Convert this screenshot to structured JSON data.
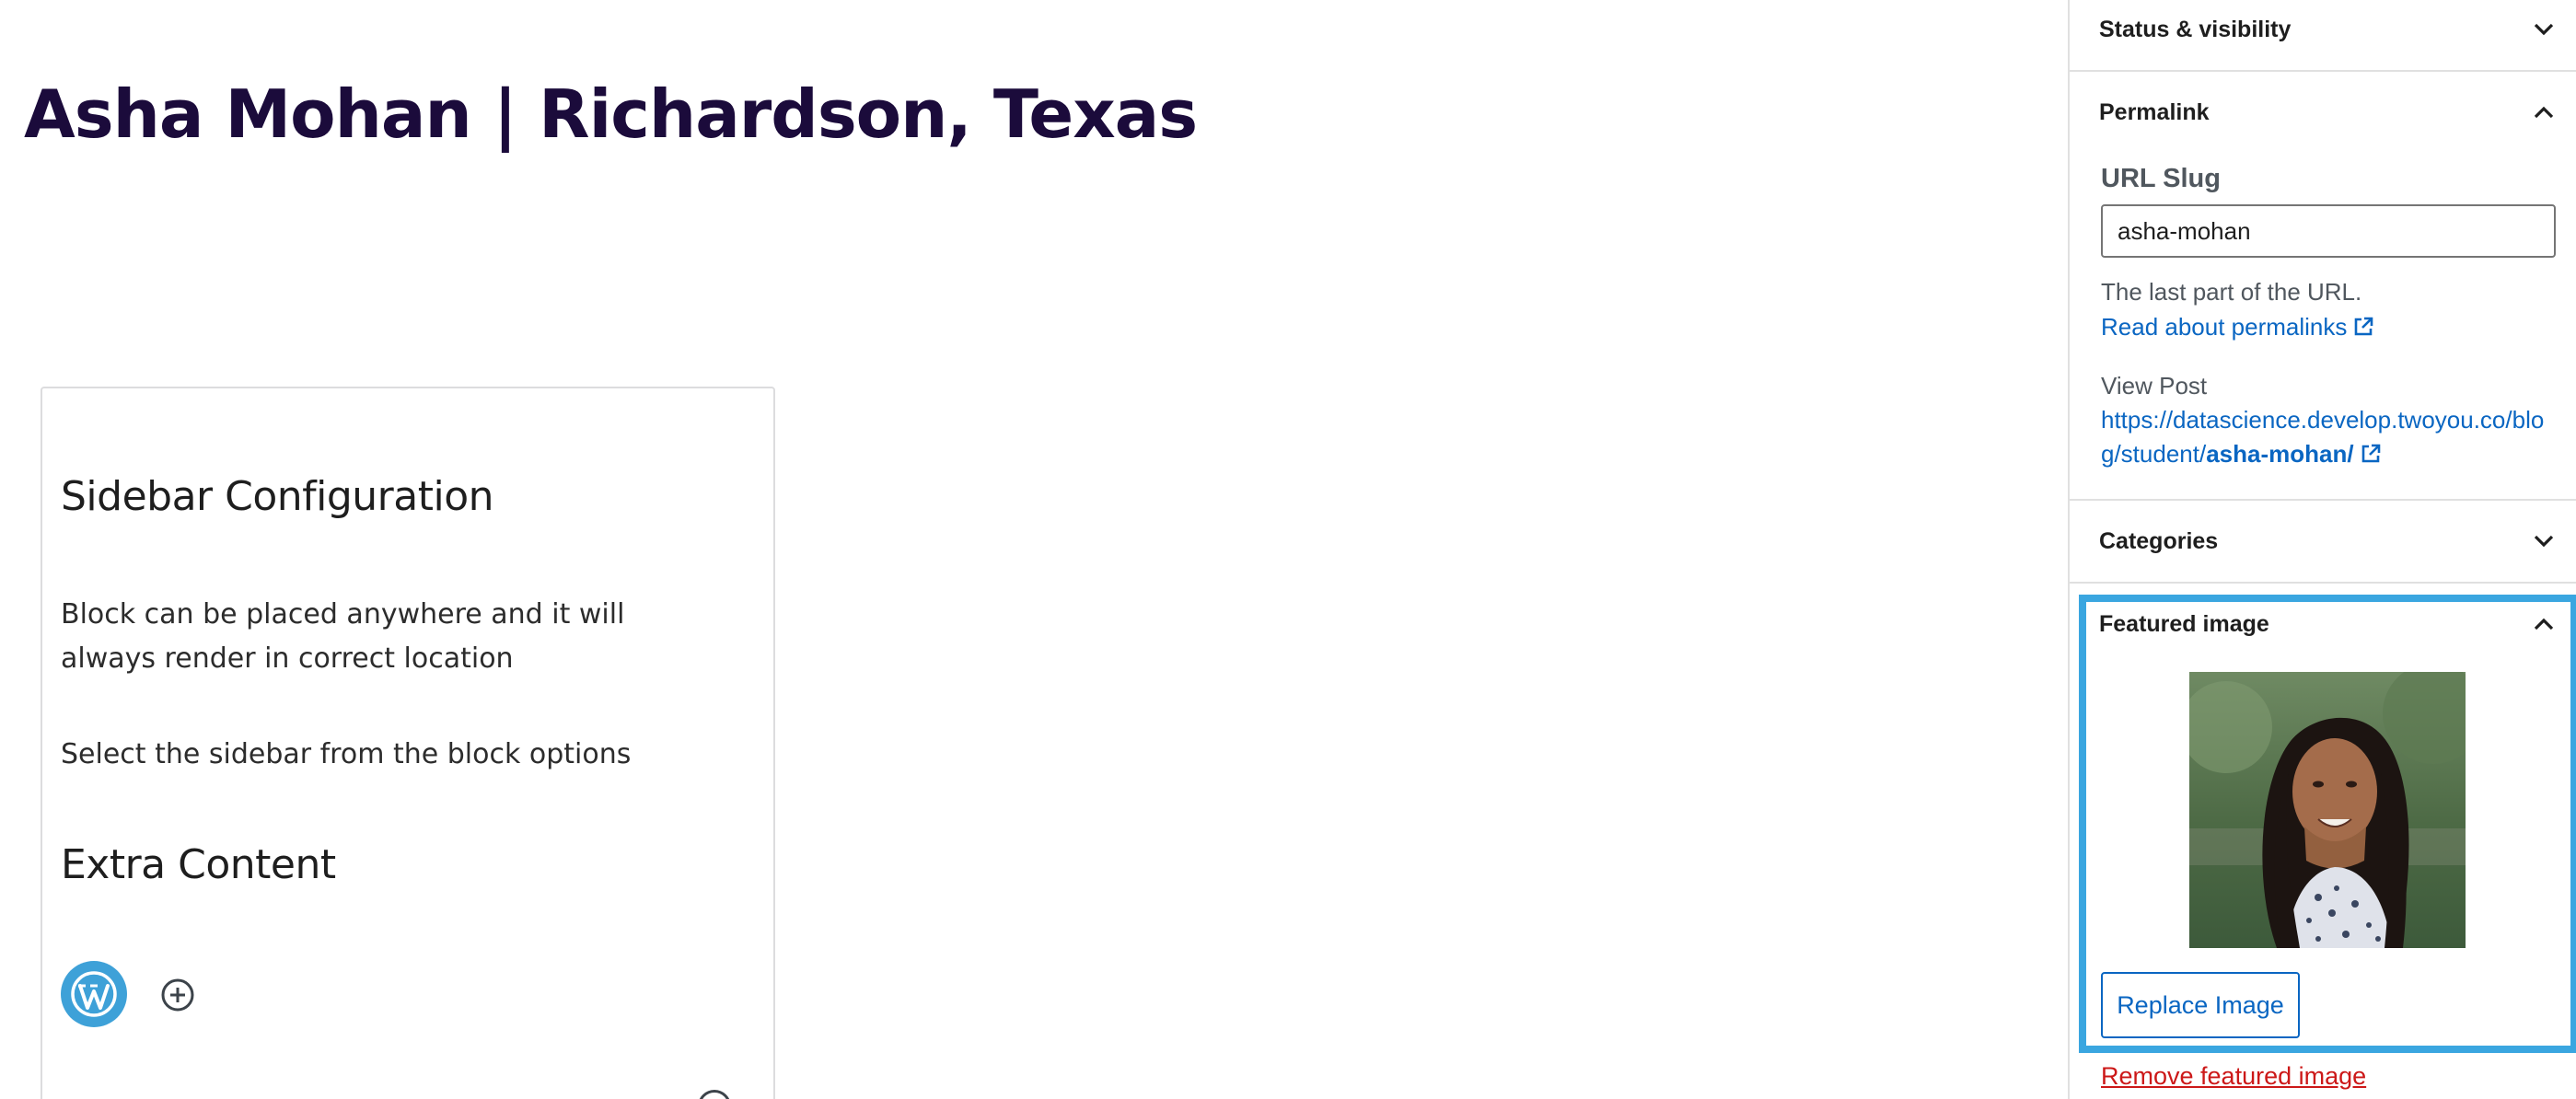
{
  "editor": {
    "post_title": "Asha Mohan | Richardson, Texas",
    "block": {
      "heading_1": "Sidebar Configuration",
      "text_1": "Block can be placed anywhere and it will always render in correct location",
      "text_2": "Select the sidebar from the block options",
      "heading_2": "Extra Content",
      "logo_icon": "wordpress-logo-icon",
      "add_icon": "plus-circle-icon"
    }
  },
  "sidebar": {
    "status_visibility": {
      "title": "Status & visibility",
      "icon": "chevron-down-icon"
    },
    "permalink": {
      "title": "Permalink",
      "icon": "chevron-up-icon",
      "slug_label": "URL Slug",
      "slug_value": "asha-mohan",
      "help_text": "The last part of the URL.",
      "read_link": "Read about permalinks",
      "view_post_label": "View Post",
      "view_url_prefix": "https://datascience.develop.twoyou.co/blog/student/",
      "view_url_slug": "asha-mohan/"
    },
    "categories": {
      "title": "Categories",
      "icon": "chevron-down-icon"
    },
    "featured_image": {
      "title": "Featured image",
      "icon": "chevron-up-icon",
      "replace_label": "Replace Image",
      "remove_label": "Remove featured image"
    }
  },
  "colors": {
    "title": "#1b0b3b",
    "link": "#0a66c2",
    "highlight": "#3aa6e0",
    "danger": "#cc1818",
    "wp_logo": "#3ea1d8"
  }
}
